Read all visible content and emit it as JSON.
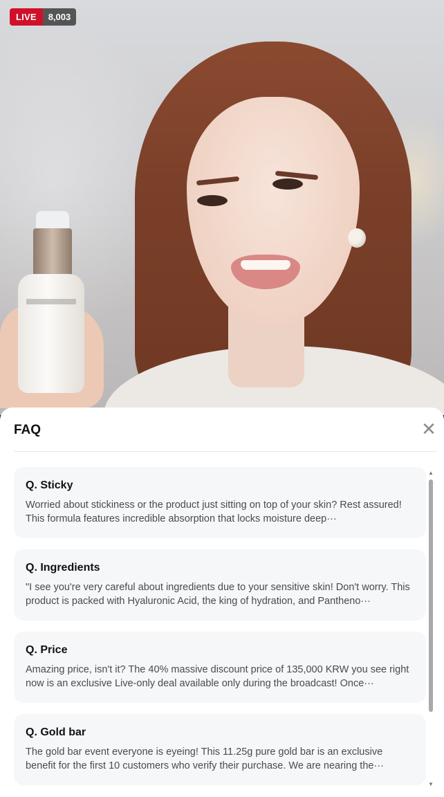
{
  "live_badge": {
    "label": "LIVE",
    "viewer_count": "8,003"
  },
  "faq": {
    "title": "FAQ",
    "close_icon": "close-icon",
    "items": [
      {
        "question": "Q. Sticky",
        "answer": "Worried about stickiness or the product just sitting on top of your skin? Rest assured! This formula features incredible absorption that locks moisture deep···"
      },
      {
        "question": "Q. Ingredients",
        "answer": "\"I see you're very careful about ingredients due to your sensitive skin! Don't worry. This product is packed with Hyaluronic Acid, the king of hydration, and Pantheno···"
      },
      {
        "question": "Q. Price",
        "answer": "Amazing price, isn't it? The 40% massive discount price of 135,000 KRW you see right now is an exclusive Live-only deal available only during the broadcast! Once···"
      },
      {
        "question": "Q. Gold bar",
        "answer": "The gold bar event everyone is eyeing! This 11.25g pure gold bar is an exclusive benefit for the first 10 customers who verify their purchase. We are nearing the···"
      }
    ]
  },
  "colors": {
    "live_red": "#d0102a",
    "sheet_bg": "#ffffff",
    "card_bg": "#f6f7f9"
  }
}
